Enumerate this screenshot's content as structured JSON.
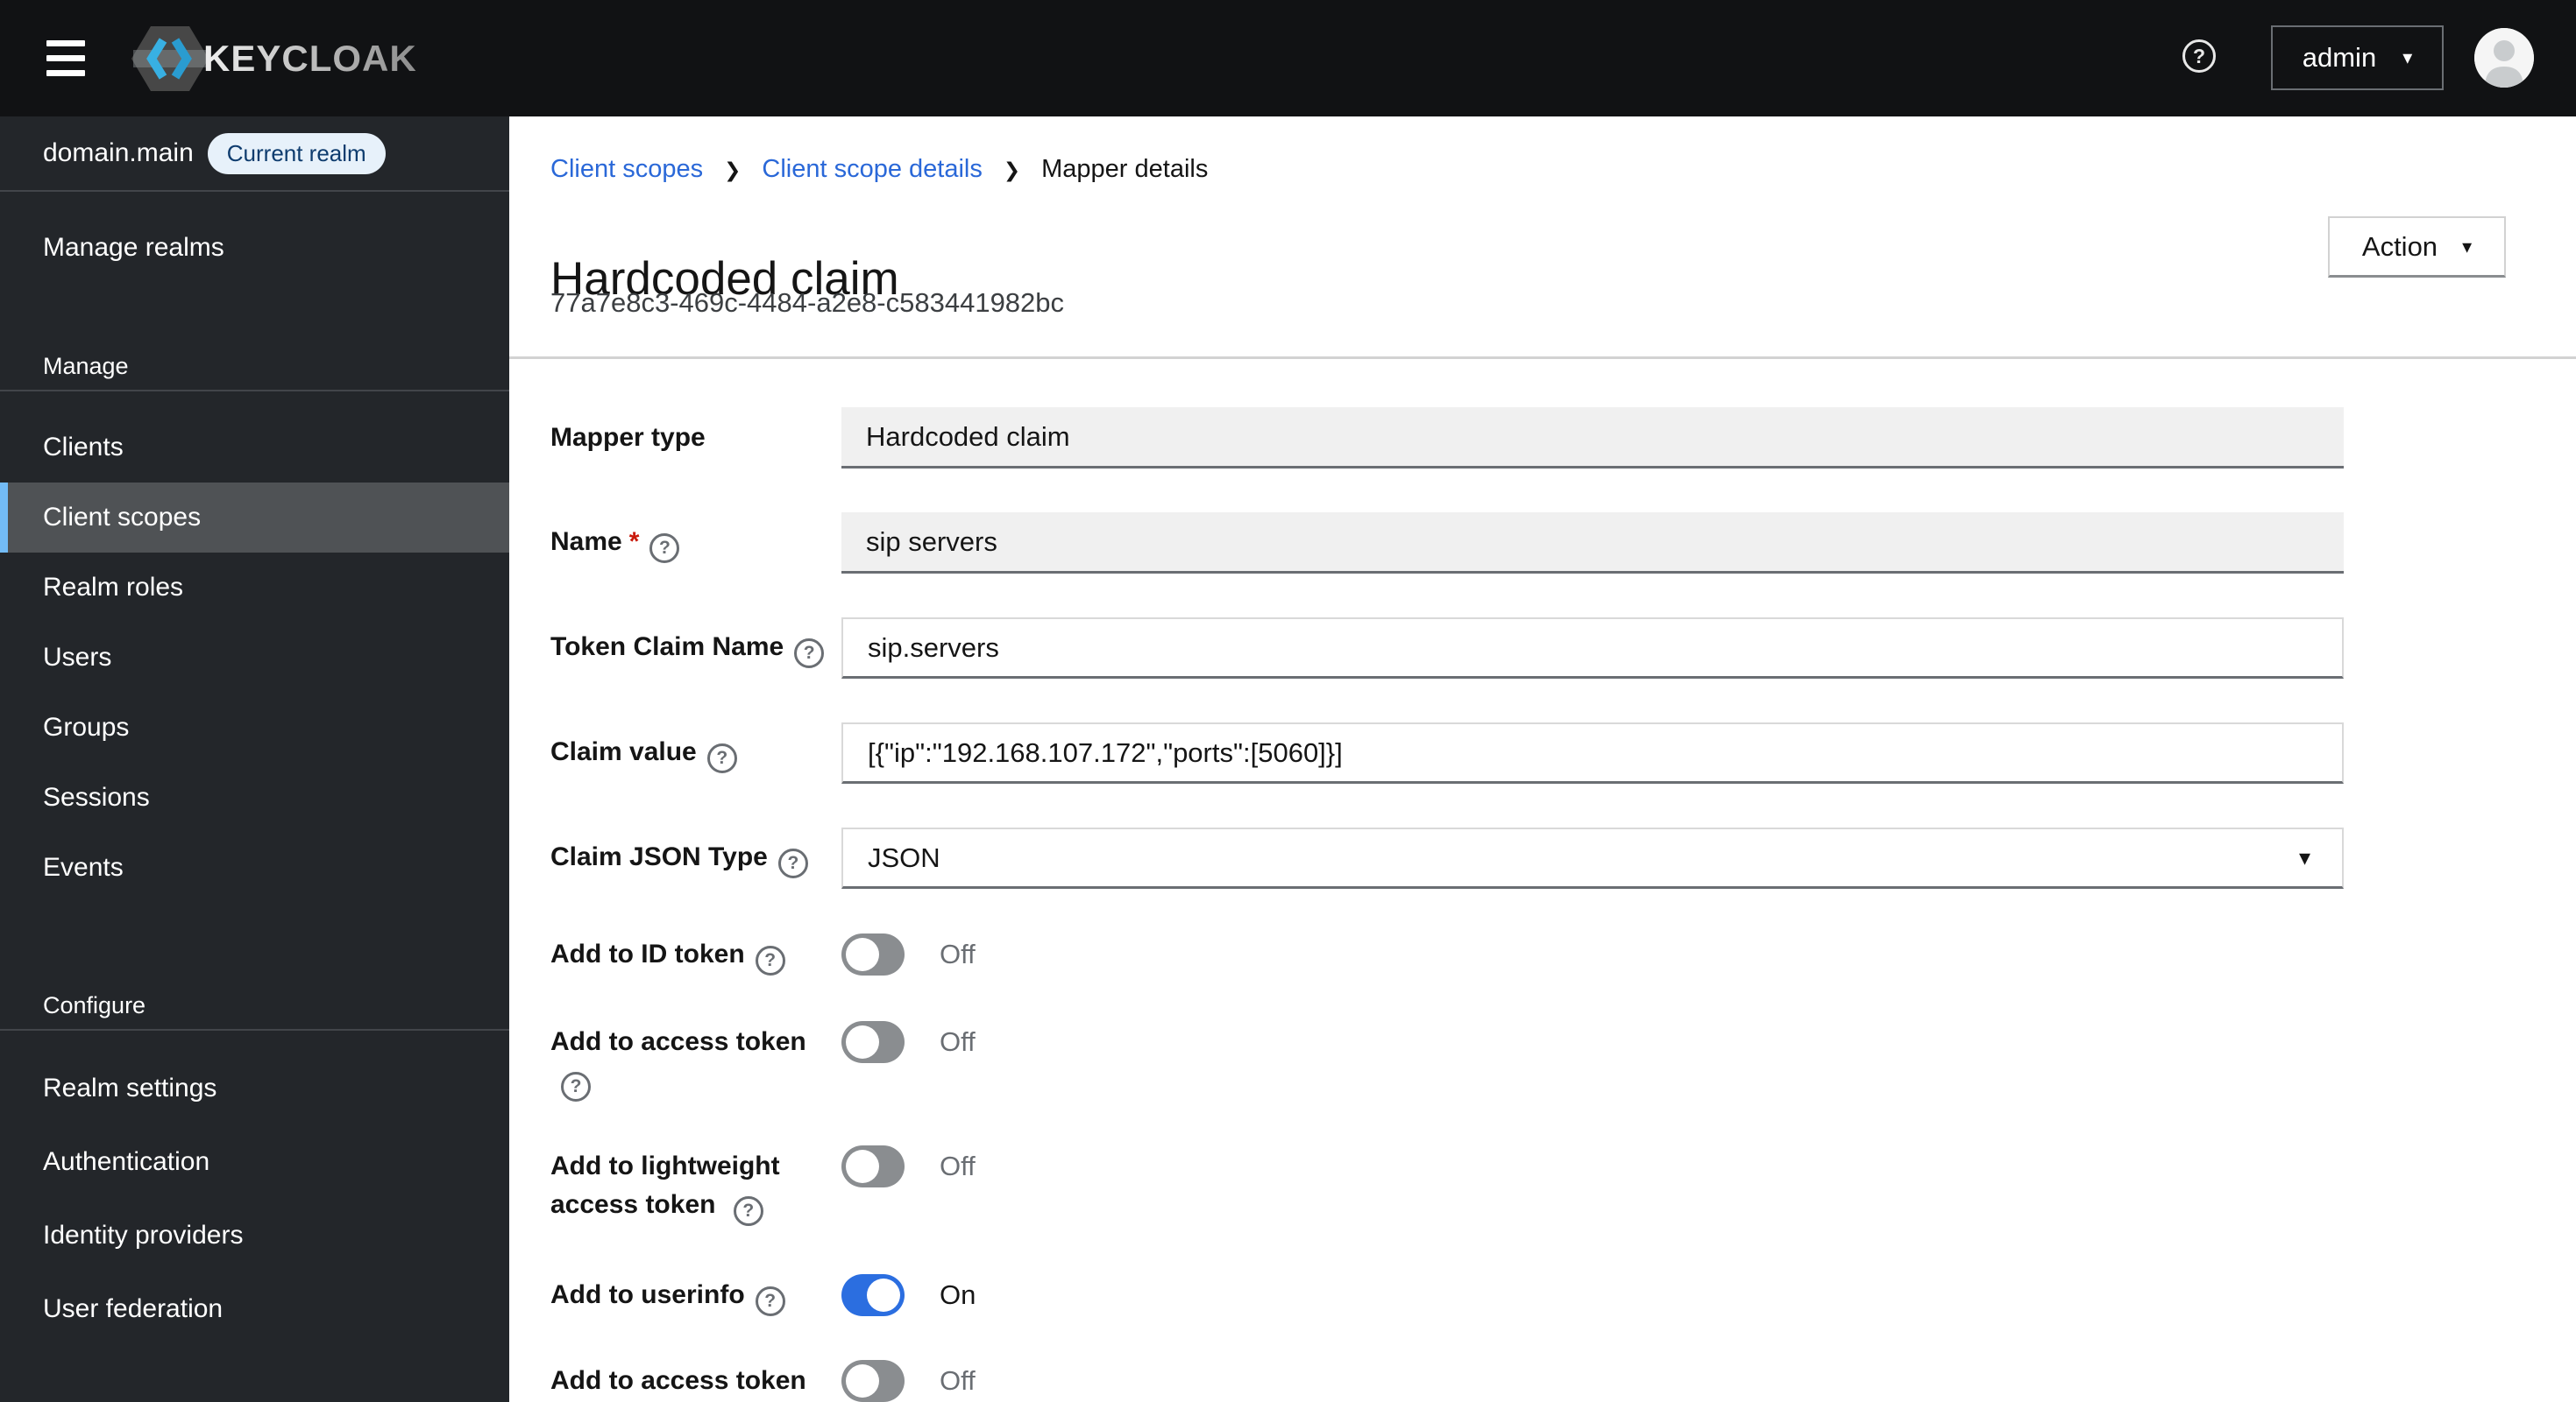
{
  "header": {
    "brand": "KEYCLOAK",
    "user": "admin"
  },
  "icons": {
    "question_glyph": "?",
    "caret_down": "▾",
    "breadcrumb_separator": "❯"
  },
  "sidebar": {
    "realm": {
      "name": "domain.main",
      "badge": "Current realm"
    },
    "top_items": [
      {
        "label": "Manage realms"
      }
    ],
    "sections": [
      {
        "label": "Manage",
        "items": [
          "Clients",
          "Client scopes",
          "Realm roles",
          "Users",
          "Groups",
          "Sessions",
          "Events"
        ],
        "selected": "Client scopes"
      },
      {
        "label": "Configure",
        "items": [
          "Realm settings",
          "Authentication",
          "Identity providers",
          "User federation"
        ]
      }
    ]
  },
  "breadcrumb": [
    "Client scopes",
    "Client scope details",
    "Mapper details"
  ],
  "page": {
    "title": "Hardcoded claim",
    "subtitle": "77a7e8c3-469c-4484-a2e8-c583441982bc",
    "action": "Action"
  },
  "form": {
    "required_marker": "*",
    "fields": [
      {
        "label": "Mapper type",
        "value": "Hardcoded claim"
      },
      {
        "label": "Name",
        "value": "sip servers"
      },
      {
        "label": "Token Claim Name",
        "value": "sip.servers"
      },
      {
        "label": "Claim value",
        "value": "[{\"ip\":\"192.168.107.172\",\"ports\":[5060]}]"
      },
      {
        "label": "Claim JSON Type",
        "value": "JSON"
      }
    ],
    "toggles": [
      {
        "label": "Add to ID token",
        "state": "Off"
      },
      {
        "label": "Add to access token",
        "state": "Off"
      },
      {
        "label": "Add to lightweight access token",
        "state": "Off"
      },
      {
        "label": "Add to userinfo",
        "state": "On"
      },
      {
        "label": "Add to access token",
        "state": "Off"
      }
    ]
  },
  "colors": {
    "masthead_bg": "#111214",
    "sidebar_bg": "#23262a",
    "selected_item_bg": "#4f5255",
    "selected_accent": "#73bcf7",
    "link_blue": "#2a68d8",
    "toggle_on_blue": "#2b6ee0",
    "badge_bg": "#e7f1fa",
    "badge_text": "#0e3c6e",
    "required_red": "#c9190b"
  }
}
